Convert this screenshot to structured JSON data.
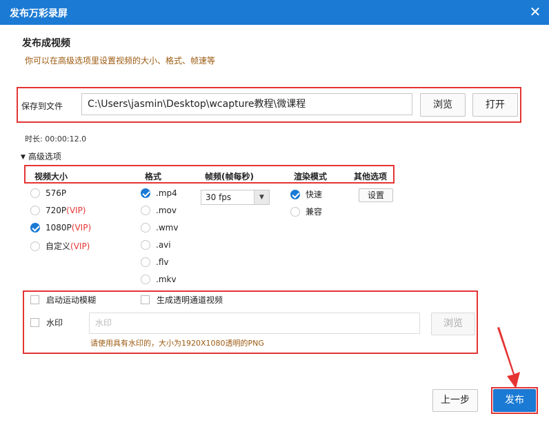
{
  "window": {
    "title": "发布万彩录屏"
  },
  "header": {
    "title": "发布成视频",
    "subtitle": "你可以在高级选项里设置视频的大小、格式、帧速等"
  },
  "save": {
    "label": "保存到文件",
    "path": "C:\\Users\\jasmin\\Desktop\\wcapture教程\\微课程",
    "browse_label": "浏览",
    "open_label": "打开"
  },
  "duration": "时长: 00:00:12.0",
  "advanced": {
    "toggle_label": "高级选项",
    "columns": {
      "size": "视频大小",
      "format": "格式",
      "fps": "帧频(帧每秒)",
      "render": "渲染模式",
      "other": "其他选项"
    },
    "sizes": [
      {
        "label": "576P",
        "vip": "",
        "checked": false
      },
      {
        "label": "720P",
        "vip": "(VIP)",
        "checked": false
      },
      {
        "label": "1080P",
        "vip": "(VIP)",
        "checked": true
      },
      {
        "label": "自定义",
        "vip": "(VIP)",
        "checked": false
      }
    ],
    "formats": [
      {
        "label": ".mp4",
        "checked": true
      },
      {
        "label": ".mov",
        "checked": false
      },
      {
        "label": ".wmv",
        "checked": false
      },
      {
        "label": ".avi",
        "checked": false
      },
      {
        "label": ".flv",
        "checked": false
      },
      {
        "label": ".mkv",
        "checked": false
      }
    ],
    "fps_value": "30 fps",
    "render_modes": [
      {
        "label": "快速",
        "checked": true
      },
      {
        "label": "兼容",
        "checked": false
      }
    ],
    "settings_label": "设置"
  },
  "effects": {
    "motion_blur_label": "启动运动模糊",
    "alpha_label": "生成透明通道视频",
    "watermark_label": "水印",
    "watermark_placeholder": "水印",
    "watermark_browse": "浏览",
    "watermark_hint": "请使用具有水印的，大小为1920X1080透明的PNG"
  },
  "footer": {
    "prev_label": "上一步",
    "publish_label": "发布"
  },
  "colors": {
    "accent": "#1a7ad4",
    "highlight": "#e53333",
    "hint": "#9c5a10"
  }
}
